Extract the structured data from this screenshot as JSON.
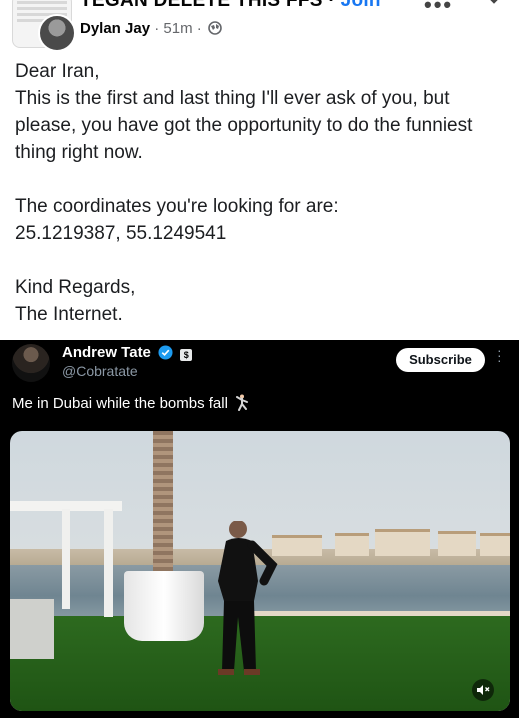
{
  "header": {
    "group_name": "TEGAN DELETE THIS FFS",
    "join_label": "Join",
    "author": "Dylan Jay",
    "time": "51m",
    "more_icon": "more-dots-icon",
    "close_icon": "close-icon"
  },
  "post": {
    "lines": [
      "Dear Iran,",
      "This is the first and last thing I'll ever ask of you, but please, you have got the opportunity to do the funniest thing right now.",
      "",
      "The coordinates you're looking for are:",
      "25.1219387, 55.1249541",
      "",
      "Kind Regards,",
      "The Internet."
    ]
  },
  "tweet": {
    "name": "Andrew Tate",
    "handle": "@Cobratate",
    "subscribe_label": "Subscribe",
    "text": "Me in Dubai while the bombs fall",
    "colors": {
      "background": "#000000",
      "verified": "#1d9bf0"
    }
  }
}
